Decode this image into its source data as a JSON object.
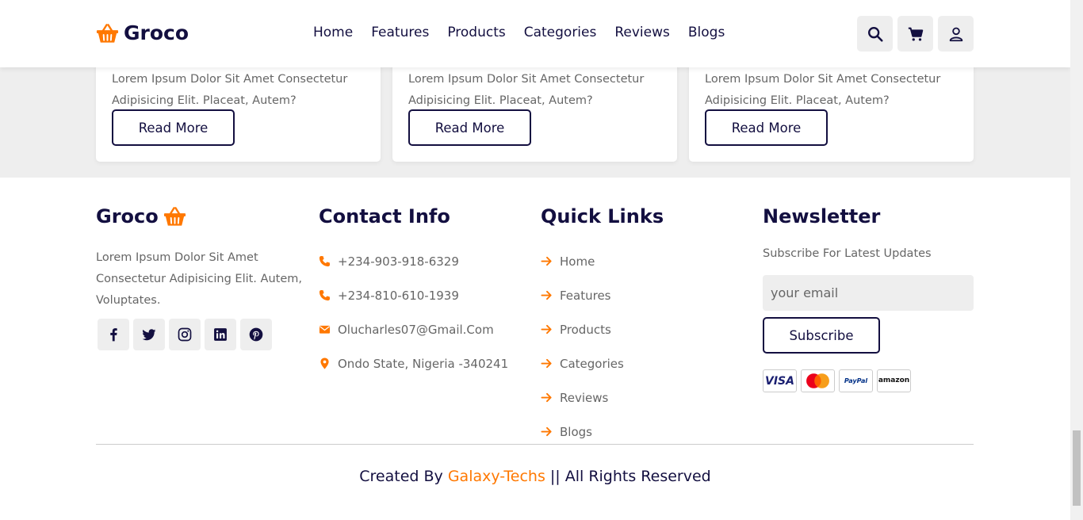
{
  "header": {
    "logo_text": "Groco",
    "nav": [
      "Home",
      "Features",
      "Products",
      "Categories",
      "Reviews",
      "Blogs"
    ],
    "icons": [
      "search-icon",
      "cart-icon",
      "user-icon"
    ]
  },
  "cards": [
    {
      "text": "Lorem Ipsum Dolor Sit Amet Consectetur Adipisicing Elit. Placeat, Autem?",
      "button": "Read More"
    },
    {
      "text": "Lorem Ipsum Dolor Sit Amet Consectetur Adipisicing Elit. Placeat, Autem?",
      "button": "Read More"
    },
    {
      "text": "Lorem Ipsum Dolor Sit Amet Consectetur Adipisicing Elit. Placeat, Autem?",
      "button": "Read More"
    }
  ],
  "footer": {
    "about": {
      "title": "Groco",
      "text": "Lorem Ipsum Dolor Sit Amet Consectetur Adipisicing Elit. Autem, Voluptates.",
      "socials": [
        "facebook-icon",
        "twitter-icon",
        "instagram-icon",
        "linkedin-icon",
        "pinterest-icon"
      ]
    },
    "contact": {
      "title": "Contact Info",
      "items": [
        "+234-903-918-6329",
        "+234-810-610-1939",
        "Olucharles07@Gmail.Com",
        "Ondo State, Nigeria -340241"
      ]
    },
    "links": {
      "title": "Quick Links",
      "items": [
        "Home",
        "Features",
        "Products",
        "Categories",
        "Reviews",
        "Blogs"
      ]
    },
    "newsletter": {
      "title": "Newsletter",
      "text": "Subscribe For Latest Updates",
      "email_placeholder": "your email",
      "button": "Subscribe",
      "payments": [
        "VISA",
        "MasterCard",
        "PayPal",
        "amazon"
      ]
    },
    "credit": {
      "prefix": "Created By",
      "brand": "Galaxy-Techs",
      "suffix": "|| All Rights Reserved"
    }
  },
  "colors": {
    "accent": "#ff7800",
    "dark": "#130f40",
    "muted": "#666666",
    "light_bg": "#eeeeee"
  }
}
